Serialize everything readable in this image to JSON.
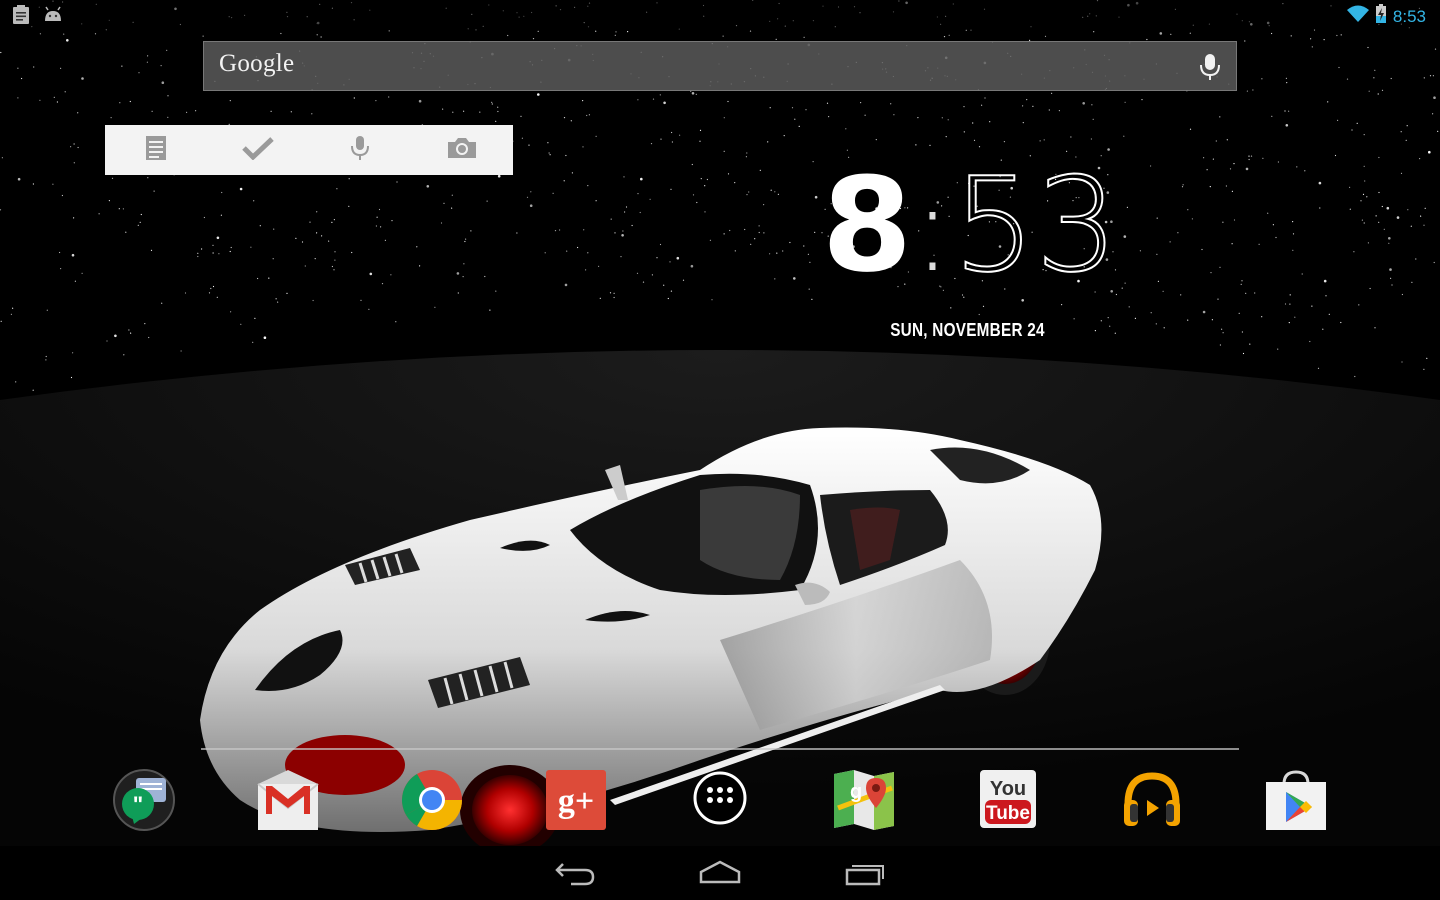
{
  "status_bar": {
    "clock": "8:53",
    "left_icons": [
      "clipboard-notification-icon",
      "android-debug-icon"
    ],
    "right_icons": [
      "wifi-icon",
      "battery-charging-icon"
    ],
    "clock_color": "#33b5e5"
  },
  "search": {
    "logo": "Google",
    "mic_icon": "microphone-icon"
  },
  "keep_widget": {
    "buttons": [
      "new-note-icon",
      "checklist-icon",
      "voice-note-icon",
      "camera-note-icon"
    ]
  },
  "clock_widget": {
    "hours": "8",
    "separator": ":",
    "minutes": "53",
    "date": "SUN, NOVEMBER 24"
  },
  "dock": {
    "apps": [
      {
        "name": "Hangouts",
        "icon": "hangouts-icon"
      },
      {
        "name": "Gmail",
        "icon": "gmail-icon"
      },
      {
        "name": "Chrome",
        "icon": "chrome-icon"
      },
      {
        "name": "Google+",
        "icon": "google-plus-icon"
      },
      {
        "name": "All apps",
        "icon": "all-apps-icon"
      },
      {
        "name": "Maps",
        "icon": "maps-icon"
      },
      {
        "name": "YouTube",
        "icon": "youtube-icon"
      },
      {
        "name": "Play Music",
        "icon": "play-music-icon"
      },
      {
        "name": "Play Store",
        "icon": "play-store-icon"
      }
    ],
    "gplus_label": "g+",
    "youtube_top": "You",
    "youtube_bottom": "Tube"
  },
  "nav_bar": {
    "buttons": [
      "back-icon",
      "home-icon",
      "recents-icon"
    ]
  }
}
